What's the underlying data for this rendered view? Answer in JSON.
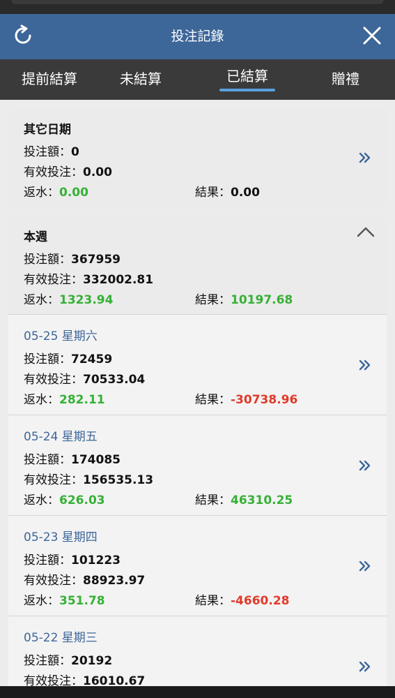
{
  "header": {
    "title": "投注記錄",
    "refresh_icon": "refresh-icon",
    "close_icon": "close-icon"
  },
  "tabs": [
    {
      "label": "提前結算",
      "active": false
    },
    {
      "label": "未結算",
      "active": false
    },
    {
      "label": "已結算",
      "active": true
    },
    {
      "label": "贈禮",
      "active": false
    }
  ],
  "labels": {
    "bet": "投注額：",
    "valid": "有效投注：",
    "rebate": "返水：",
    "result": "結果："
  },
  "other_dates": {
    "title": "其它日期",
    "bet": "0",
    "valid": "0.00",
    "rebate": "0.00",
    "result": "0.00"
  },
  "this_week": {
    "title": "本週",
    "bet": "367959",
    "valid": "332002.81",
    "rebate": "1323.94",
    "result": "10197.68"
  },
  "days": [
    {
      "date": "05-25 星期六",
      "bet": "72459",
      "valid": "70533.04",
      "rebate": "282.11",
      "result": "-30738.96"
    },
    {
      "date": "05-24 星期五",
      "bet": "174085",
      "valid": "156535.13",
      "rebate": "626.03",
      "result": "46310.25"
    },
    {
      "date": "05-23 星期四",
      "bet": "101223",
      "valid": "88923.97",
      "rebate": "351.78",
      "result": "-4660.28"
    },
    {
      "date": "05-22 星期三",
      "bet": "20192",
      "valid": "16010.67"
    }
  ],
  "colors": {
    "header_bg": "#3d6699",
    "tab_bg": "#3a3a3a",
    "accent": "#5aa0e0",
    "positive": "#35b135",
    "negative": "#e03a2a",
    "date": "#3d6699"
  }
}
